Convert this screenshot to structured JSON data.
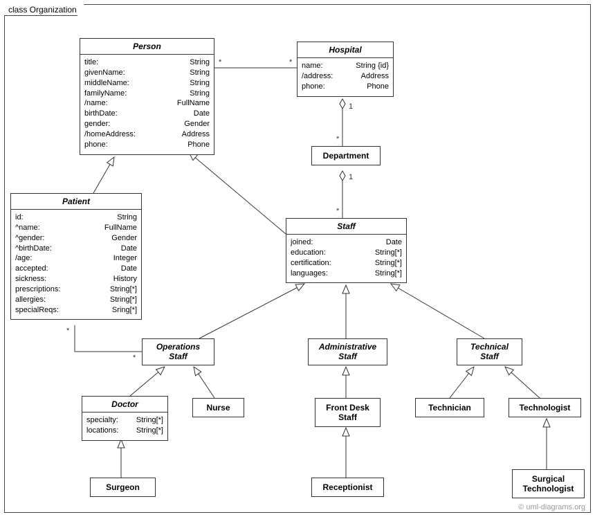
{
  "frame": {
    "title": "class Organization"
  },
  "classes": {
    "person": {
      "name": "Person",
      "attrs": [
        {
          "n": "title:",
          "t": "String"
        },
        {
          "n": "givenName:",
          "t": "String"
        },
        {
          "n": "middleName:",
          "t": "String"
        },
        {
          "n": "familyName:",
          "t": "String"
        },
        {
          "n": "/name:",
          "t": "FullName"
        },
        {
          "n": "birthDate:",
          "t": "Date"
        },
        {
          "n": "gender:",
          "t": "Gender"
        },
        {
          "n": "/homeAddress:",
          "t": "Address"
        },
        {
          "n": "phone:",
          "t": "Phone"
        }
      ]
    },
    "hospital": {
      "name": "Hospital",
      "attrs": [
        {
          "n": "name:",
          "t": "String {id}"
        },
        {
          "n": "/address:",
          "t": "Address"
        },
        {
          "n": "phone:",
          "t": "Phone"
        }
      ]
    },
    "department": {
      "name": "Department"
    },
    "patient": {
      "name": "Patient",
      "attrs": [
        {
          "n": "id:",
          "t": "String"
        },
        {
          "n": "^name:",
          "t": "FullName"
        },
        {
          "n": "^gender:",
          "t": "Gender"
        },
        {
          "n": "^birthDate:",
          "t": "Date"
        },
        {
          "n": "/age:",
          "t": "Integer"
        },
        {
          "n": "accepted:",
          "t": "Date"
        },
        {
          "n": "sickness:",
          "t": "History"
        },
        {
          "n": "prescriptions:",
          "t": "String[*]"
        },
        {
          "n": "allergies:",
          "t": "String[*]"
        },
        {
          "n": "specialReqs:",
          "t": "Sring[*]"
        }
      ]
    },
    "staff": {
      "name": "Staff",
      "attrs": [
        {
          "n": "joined:",
          "t": "Date"
        },
        {
          "n": "education:",
          "t": "String[*]"
        },
        {
          "n": "certification:",
          "t": "String[*]"
        },
        {
          "n": "languages:",
          "t": "String[*]"
        }
      ]
    },
    "opsStaff": {
      "line1": "Operations",
      "line2": "Staff"
    },
    "adminStaff": {
      "line1": "Administrative",
      "line2": "Staff"
    },
    "techStaff": {
      "line1": "Technical",
      "line2": "Staff"
    },
    "doctor": {
      "name": "Doctor",
      "attrs": [
        {
          "n": "specialty:",
          "t": "String[*]"
        },
        {
          "n": "locations:",
          "t": "String[*]"
        }
      ]
    },
    "nurse": {
      "name": "Nurse"
    },
    "frontDesk": {
      "line1": "Front Desk",
      "line2": "Staff"
    },
    "technician": {
      "name": "Technician"
    },
    "technologist": {
      "name": "Technologist"
    },
    "surgeon": {
      "name": "Surgeon"
    },
    "receptionist": {
      "name": "Receptionist"
    },
    "surgTech": {
      "line1": "Surgical",
      "line2": "Technologist"
    }
  },
  "mult": {
    "star": "*",
    "one": "1"
  },
  "watermark": "© uml-diagrams.org"
}
